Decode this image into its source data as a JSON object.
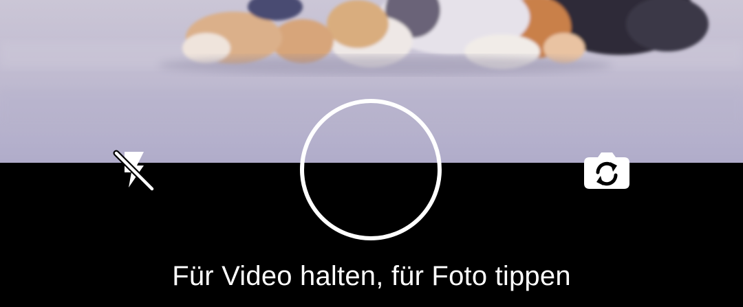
{
  "camera": {
    "hint": "Für Video halten, für Foto tippen"
  },
  "icons": {
    "flash": "flash-off-icon",
    "shutter": "shutter-ring-icon",
    "switch_camera": "switch-camera-icon"
  },
  "colors": {
    "controls_background": "#000000",
    "icon_color": "#ffffff",
    "preview_floor": "#bdb8cf"
  }
}
